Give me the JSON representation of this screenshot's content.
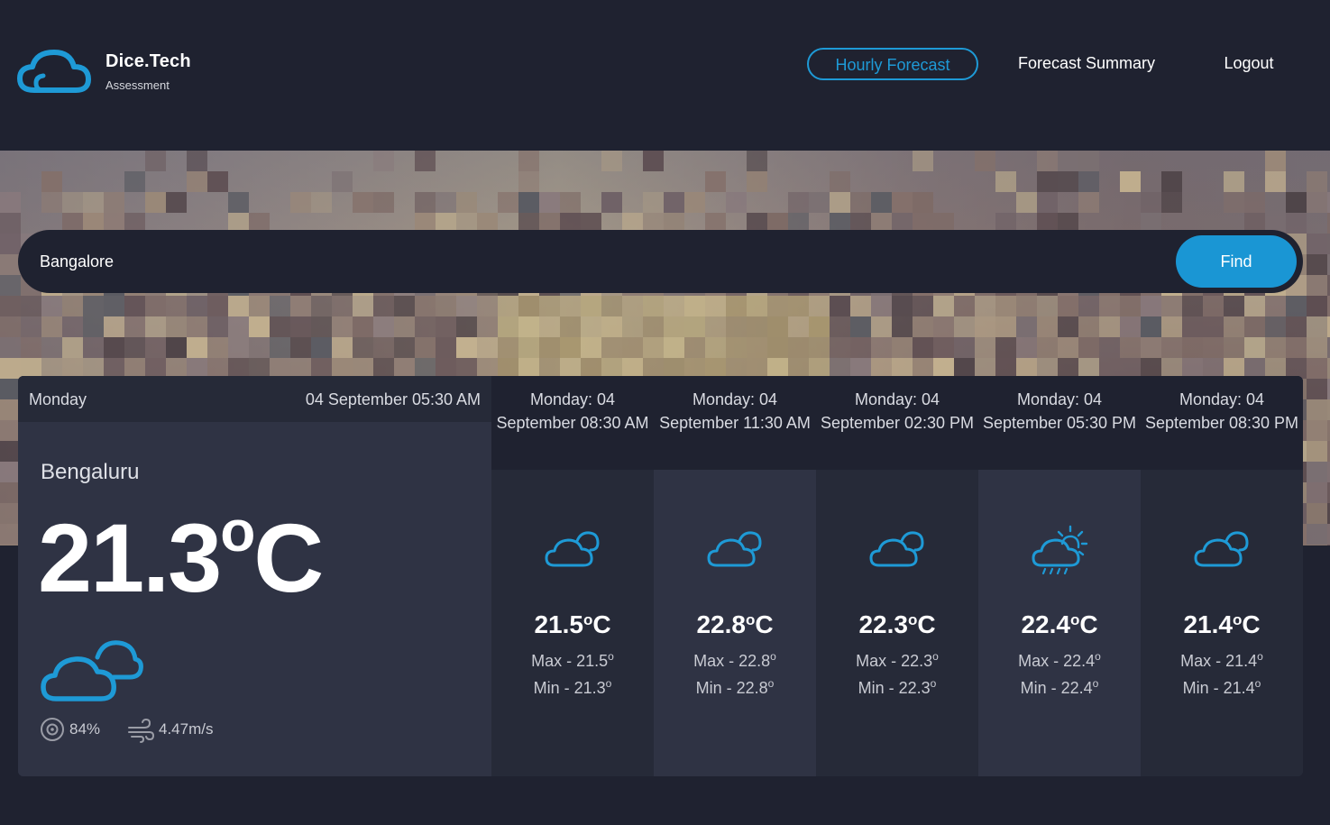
{
  "brand": {
    "name": "Dice.Tech",
    "subtitle": "Assessment",
    "accent": "#1e9ad6"
  },
  "nav": {
    "hourly_label": "Hourly Forecast",
    "summary_label": "Forecast Summary",
    "logout_label": "Logout",
    "active": "Hourly Forecast"
  },
  "search": {
    "value": "Bangalore",
    "button_label": "Find"
  },
  "current": {
    "day": "Monday",
    "datetime": "04 September 05:30 AM",
    "city": "Bengaluru",
    "temp": "21.3",
    "unit_deg": "o",
    "unit_c": "C",
    "icon": "cloudy-icon",
    "humidity": "84%",
    "humidity_icon": "humidity-icon",
    "wind": "4.47m/s",
    "wind_icon": "wind-icon"
  },
  "hourly": [
    {
      "label": "Monday: 04 September 08:30 AM",
      "icon": "cloudy-icon",
      "temp": "21.5",
      "max_label": "Max - 21.5",
      "min_label": "Min - 21.3"
    },
    {
      "label": "Monday: 04 September 11:30 AM",
      "icon": "cloudy-icon",
      "temp": "22.8",
      "max_label": "Max - 22.8",
      "min_label": "Min - 22.8"
    },
    {
      "label": "Monday: 04 September 02:30 PM",
      "icon": "cloudy-icon",
      "temp": "22.3",
      "max_label": "Max - 22.3",
      "min_label": "Min - 22.3"
    },
    {
      "label": "Monday: 04 September 05:30 PM",
      "icon": "sun-rain-icon",
      "temp": "22.4",
      "max_label": "Max - 22.4",
      "min_label": "Min - 22.4"
    },
    {
      "label": "Monday: 04 September 08:30 PM",
      "icon": "cloudy-icon",
      "temp": "21.4",
      "max_label": "Max - 21.4",
      "min_label": "Min - 21.4"
    }
  ],
  "deg": "o",
  "unit_c": "C"
}
